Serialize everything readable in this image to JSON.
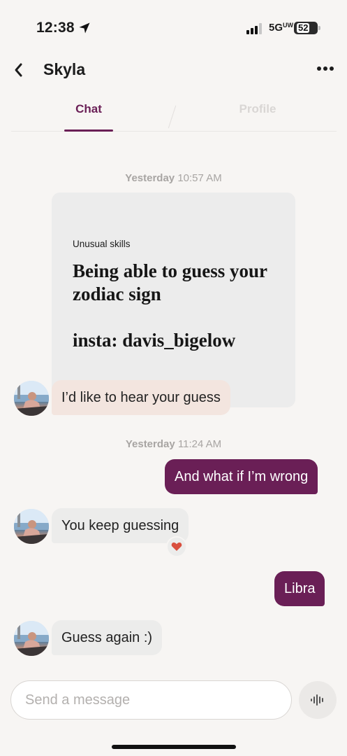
{
  "status_bar": {
    "time": "12:38",
    "network": "5G",
    "network_suffix": "UW",
    "battery": "52",
    "icons": [
      "location-arrow-icon",
      "signal-icon",
      "battery-icon"
    ]
  },
  "header": {
    "title": "Skyla",
    "back_icon": "chevron-left-icon",
    "more_icon": "more-dots-icon"
  },
  "tabs": [
    {
      "label": "Chat",
      "active": true
    },
    {
      "label": "Profile",
      "active": false
    }
  ],
  "accent_color": "#6a1f56",
  "messages": {
    "timestamp_1": {
      "day": "Yesterday",
      "time": "10:57 AM"
    },
    "prompt": {
      "question": "Unusual skills",
      "answer": "Being able to guess your zodiac sign\n\ninsta: davis_bigelow"
    },
    "msg_1": "I’d like to hear your guess",
    "timestamp_2": {
      "day": "Yesterday",
      "time": "11:24 AM"
    },
    "msg_2": "And what if I’m wrong",
    "msg_3": "You keep guessing",
    "msg_3_reaction": "heart-icon",
    "msg_4": "Libra",
    "msg_5": "Guess again :)"
  },
  "composer": {
    "placeholder": "Send a message",
    "voice_icon": "voice-waveform-icon"
  }
}
